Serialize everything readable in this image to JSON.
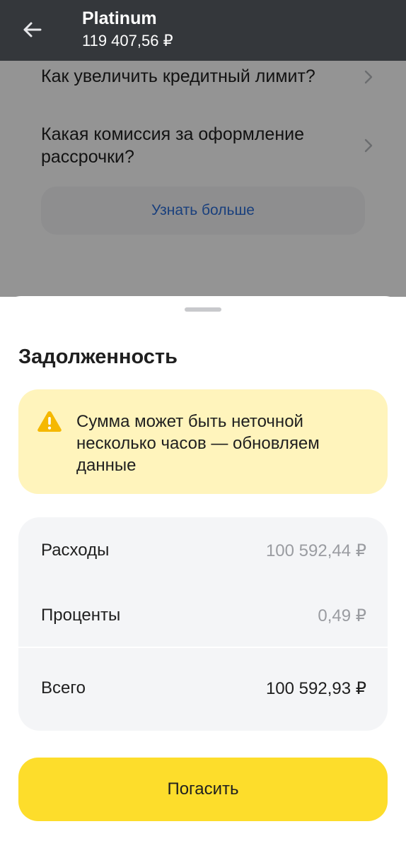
{
  "header": {
    "title": "Platinum",
    "balance": "119 407,56 ₽",
    "back_icon": "arrow-left-icon"
  },
  "faq": {
    "items": [
      {
        "question": "Как увеличить кредитный лимит?",
        "icon": "chevron-right-icon"
      },
      {
        "question": "Какая комиссия за оформление рассрочки?",
        "icon": "chevron-right-icon"
      }
    ],
    "more_label": "Узнать больше"
  },
  "sheet": {
    "title": "Задолженность",
    "warning": {
      "icon": "warning-icon",
      "text": "Сумма может быть неточной несколько часов — обновляем данные"
    },
    "rows": [
      {
        "label": "Расходы",
        "value": "100 592,44 ₽"
      },
      {
        "label": "Проценты",
        "value": "0,49 ₽"
      },
      {
        "label": "Всего",
        "value": "100 592,93 ₽"
      }
    ],
    "pay_label": "Погасить"
  },
  "colors": {
    "app_bar": "#34373b",
    "accent_yellow": "#fddd2b",
    "warning_bg": "#fff4bc",
    "warning_icon": "#f5b800",
    "link_blue": "#2e6fd8",
    "muted_text": "#9a9ca1"
  }
}
